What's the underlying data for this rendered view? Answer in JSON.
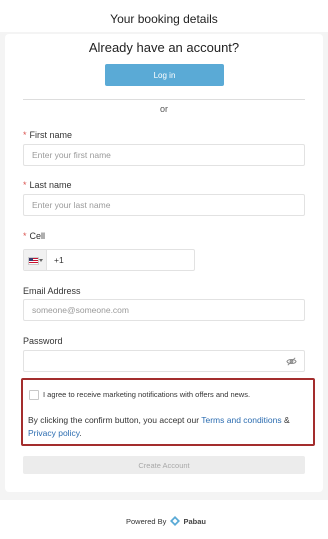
{
  "header": {
    "title": "Your booking details"
  },
  "account": {
    "title": "Already have an account?",
    "login_label": "Log in",
    "or_label": "or"
  },
  "form": {
    "first_name": {
      "label": "First name",
      "placeholder": "Enter your first name",
      "required": "*"
    },
    "last_name": {
      "label": "Last name",
      "placeholder": "Enter your last name",
      "required": "*"
    },
    "cell": {
      "label": "Cell",
      "country_code": "+1",
      "country_flag": "us-flag-icon",
      "required": "*"
    },
    "email": {
      "label": "Email Address",
      "placeholder": "someone@someone.com"
    },
    "password": {
      "label": "Password",
      "toggle_icon": "eye-slash-icon"
    }
  },
  "consent": {
    "marketing_label": "I agree to receive marketing notifications with offers and news.",
    "terms_prefix": "By clicking the confirm button, you accept our ",
    "terms_link": "Terms and conditions",
    "terms_joiner": " & ",
    "privacy_link": "Privacy policy",
    "terms_suffix": "."
  },
  "create_account_label": "Create Account",
  "footer": {
    "powered_by": "Powered By",
    "brand": "Pabau",
    "brand_icon": "pabau-logo-icon"
  },
  "colors": {
    "accent": "#5aaad6",
    "link": "#2b6cb0",
    "highlight_border": "#a32d2d",
    "required": "#d9534f"
  }
}
